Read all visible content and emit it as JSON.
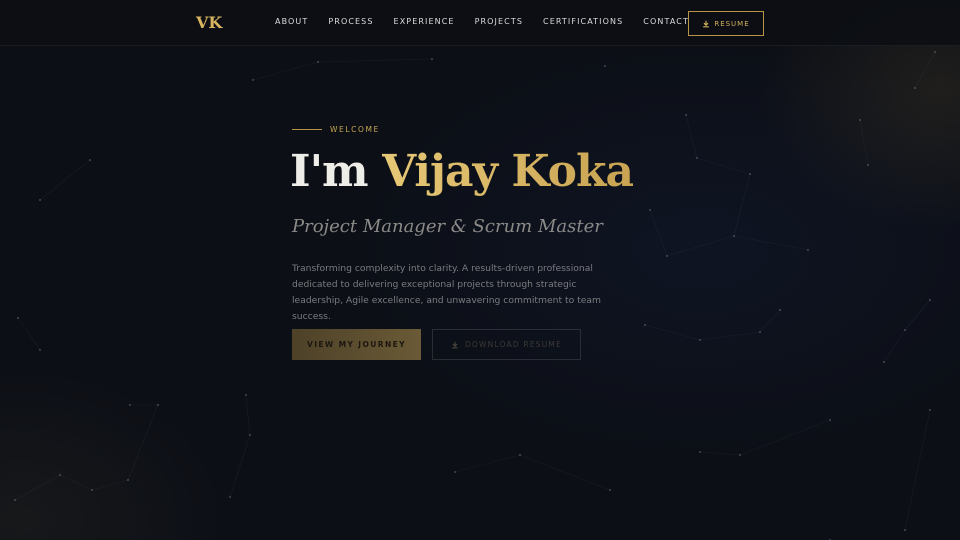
{
  "nav": {
    "logo": "VK",
    "links": [
      "ABOUT",
      "PROCESS",
      "EXPERIENCE",
      "PROJECTS",
      "CERTIFICATIONS",
      "CONTACT"
    ],
    "resume_label": "RESUME",
    "resume_icon": "download-icon"
  },
  "hero": {
    "eyebrow": "WELCOME",
    "headline_prefix": "I'm ",
    "headline_name": "Vijay Koka",
    "subtitle": "Project Manager & Scrum Master",
    "description": "Transforming complexity into clarity. A results-driven professional dedicated to delivering exceptional projects through strategic leadership, Agile excellence, and unwavering commitment to team success.",
    "primary_button": "VIEW MY JOURNEY",
    "secondary_button": "DOWNLOAD RESUME",
    "secondary_icon": "download-icon"
  },
  "colors": {
    "background": "#0c0f16",
    "accent_gold": "#d8b560",
    "text_light": "#efede8",
    "text_muted": "#7a7b7f"
  }
}
